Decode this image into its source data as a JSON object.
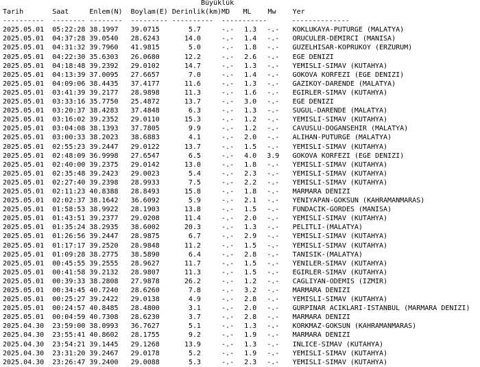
{
  "magnitude_group_title": "Büyüklük",
  "headers": {
    "date": "Tarih",
    "time": "Saat",
    "lat": "Enlem(N)",
    "lon": "Boylam(E)",
    "depth": "Derinlik(km)",
    "md": "MD",
    "ml": "ML",
    "mw": "Mw",
    "place": "Yer"
  },
  "separators": {
    "date": "----------",
    "time": "--------",
    "lat": "--------",
    "lon": "---------",
    "depth": "----------",
    "mag": "-----------",
    "place": "--------------"
  },
  "rows": [
    {
      "date": "2025.05.01",
      "time": "05:22:28",
      "lat": "38.1997",
      "lon": "39.0715",
      "depth": "5.7",
      "md": "-.-",
      "ml": "1.3",
      "mw": "-.-",
      "place": "KOKLUKAYA-PUTURGE (MALATYA)"
    },
    {
      "date": "2025.05.01",
      "time": "04:37:28",
      "lat": "39.0540",
      "lon": "28.6243",
      "depth": "14.0",
      "md": "-.-",
      "ml": "1.4",
      "mw": "-.-",
      "place": "ORUCULER-DEMIRCI (MANISA)"
    },
    {
      "date": "2025.05.01",
      "time": "04:31:32",
      "lat": "39.7960",
      "lon": "41.9815",
      "depth": "5.0",
      "md": "-.-",
      "ml": "1.8",
      "mw": "-.-",
      "place": "GUZELHISAR-KOPRUKOY (ERZURUM)"
    },
    {
      "date": "2025.05.01",
      "time": "04:22:30",
      "lat": "35.6303",
      "lon": "26.0680",
      "depth": "12.2",
      "md": "-.-",
      "ml": "2.6",
      "mw": "-.-",
      "place": "EGE DENIZI"
    },
    {
      "date": "2025.05.01",
      "time": "04:18:48",
      "lat": "39.2392",
      "lon": "29.0102",
      "depth": "14.7",
      "md": "-.-",
      "ml": "1.3",
      "mw": "-.-",
      "place": "YEMISLI-SIMAV (KUTAHYA)"
    },
    {
      "date": "2025.05.01",
      "time": "04:13:39",
      "lat": "37.0095",
      "lon": "27.6657",
      "depth": "7.0",
      "md": "-.-",
      "ml": "1.4",
      "mw": "-.-",
      "place": "GOKOVA KORFEZI (EGE DENIZI)"
    },
    {
      "date": "2025.05.01",
      "time": "04:09:06",
      "lat": "38.4435",
      "lon": "37.4177",
      "depth": "11.6",
      "md": "-.-",
      "ml": "1.3",
      "mw": "-.-",
      "place": "GAZIKOY-DARENDE (MALATYA)"
    },
    {
      "date": "2025.05.01",
      "time": "03:41:39",
      "lat": "39.2177",
      "lon": "28.9898",
      "depth": "11.3",
      "md": "-.-",
      "ml": "1.6",
      "mw": "-.-",
      "place": "EGIRLER-SIMAV (KUTAHYA)"
    },
    {
      "date": "2025.05.01",
      "time": "03:33:16",
      "lat": "35.7750",
      "lon": "25.4872",
      "depth": "13.7",
      "md": "-.-",
      "ml": "3.0",
      "mw": "-.-",
      "place": "EGE DENIZI"
    },
    {
      "date": "2025.05.01",
      "time": "03:20:37",
      "lat": "38.4283",
      "lon": "37.4848",
      "depth": "6.3",
      "md": "-.-",
      "ml": "1.3",
      "mw": "-.-",
      "place": "SUGUL-DARENDE (MALATYA)"
    },
    {
      "date": "2025.05.01",
      "time": "03:16:02",
      "lat": "39.2352",
      "lon": "29.0110",
      "depth": "15.3",
      "md": "-.-",
      "ml": "1.2",
      "mw": "-.-",
      "place": "YEMISLI-SIMAV (KUTAHYA)"
    },
    {
      "date": "2025.05.01",
      "time": "03:04:08",
      "lat": "38.1393",
      "lon": "37.7805",
      "depth": "9.9",
      "md": "-.-",
      "ml": "1.2",
      "mw": "-.-",
      "place": "CAVUSLU-DOGANSEHIR (MALATYA)"
    },
    {
      "date": "2025.05.01",
      "time": "03:00:33",
      "lat": "38.2023",
      "lon": "38.6883",
      "depth": "4.1",
      "md": "-.-",
      "ml": "2.0",
      "mw": "-.-",
      "place": "ALIHAN-PUTURGE (MALATYA)"
    },
    {
      "date": "2025.05.01",
      "time": "02:55:23",
      "lat": "39.2447",
      "lon": "29.0122",
      "depth": "13.7",
      "md": "-.-",
      "ml": "1.5",
      "mw": "-.-",
      "place": "YEMISLI-SIMAV (KUTAHYA)"
    },
    {
      "date": "2025.05.01",
      "time": "02:48:09",
      "lat": "36.9998",
      "lon": "27.6547",
      "depth": "6.5",
      "md": "-.-",
      "ml": "4.0",
      "mw": "3.9",
      "place": "GOKOVA KORFEZI (EGE DENIZI)"
    },
    {
      "date": "2025.05.01",
      "time": "02:40:00",
      "lat": "39.2375",
      "lon": "29.0142",
      "depth": "13.0",
      "md": "-.-",
      "ml": "1.8",
      "mw": "-.-",
      "place": "YEMISLI-SIMAV (KUTAHYA)"
    },
    {
      "date": "2025.05.01",
      "time": "02:35:48",
      "lat": "39.2423",
      "lon": "29.0023",
      "depth": "5.4",
      "md": "-.-",
      "ml": "2.3",
      "mw": "-.-",
      "place": "YEMISLI-SIMAV (KUTAHYA)"
    },
    {
      "date": "2025.05.01",
      "time": "02:27:40",
      "lat": "39.2398",
      "lon": "28.9933",
      "depth": "7.5",
      "md": "-.-",
      "ml": "2.2",
      "mw": "-.-",
      "place": "YEMISLI-SIMAV (KUTAHYA)"
    },
    {
      "date": "2025.05.01",
      "time": "02:11:23",
      "lat": "40.8388",
      "lat2": "",
      "lon": "28.8493",
      "depth": "15.8",
      "md": "-.-",
      "ml": "1.8",
      "mw": "-.-",
      "place": "MARMARA DENIZI"
    },
    {
      "date": "2025.05.01",
      "time": "02:02:37",
      "lat": "38.1642",
      "lon": "36.6092",
      "depth": "5.9",
      "md": "-.-",
      "ml": "2.1",
      "mw": "-.-",
      "place": "YENIYAPAN-GOKSUN (KAHRAMANMARAS)"
    },
    {
      "date": "2025.05.01",
      "time": "01:58:53",
      "lat": "38.9922",
      "lon": "28.1903",
      "depth": "13.8",
      "md": "-.-",
      "ml": "1.5",
      "mw": "-.-",
      "place": "FUNDACIK-GORDES (MANISA)"
    },
    {
      "date": "2025.05.01",
      "time": "01:43:51",
      "lat": "39.2377",
      "lon": "29.0208",
      "depth": "11.4",
      "md": "-.-",
      "ml": "2.0",
      "mw": "-.-",
      "place": "YEMISLI-SIMAV (KUTAHYA)"
    },
    {
      "date": "2025.05.01",
      "time": "01:35:24",
      "lat": "38.2935",
      "lon": "38.6002",
      "depth": "20.3",
      "md": "-.-",
      "ml": "1.3",
      "mw": "-.-",
      "place": "PELITLI-(MALATYA)"
    },
    {
      "date": "2025.05.01",
      "time": "01:26:56",
      "lat": "39.2447",
      "lon": "28.9875",
      "depth": "6.7",
      "md": "-.-",
      "ml": "2.9",
      "mw": "-.-",
      "place": "YEMISLI-SIMAV (KUTAHYA)"
    },
    {
      "date": "2025.05.01",
      "time": "01:17:17",
      "lat": "39.2520",
      "lon": "28.9848",
      "depth": "11.2",
      "md": "-.-",
      "ml": "1.5",
      "mw": "-.-",
      "place": "YEMISLI-SIMAV (KUTAHYA)"
    },
    {
      "date": "2025.05.01",
      "time": "01:09:28",
      "lat": "38.2775",
      "lon": "38.5890",
      "depth": "6.4",
      "md": "-.-",
      "ml": "2.8",
      "mw": "-.-",
      "place": "TANISIK-(MALATYA)"
    },
    {
      "date": "2025.05.01",
      "time": "00:45:55",
      "lat": "39.2555",
      "lon": "28.9627",
      "depth": "11.7",
      "md": "-.-",
      "ml": "1.5",
      "mw": "-.-",
      "place": "YENILER-SIMAV (KUTAHYA)"
    },
    {
      "date": "2025.05.01",
      "time": "00:41:58",
      "lat": "39.2132",
      "lon": "28.9807",
      "depth": "11.3",
      "md": "-.-",
      "ml": "1.5",
      "mw": "-.-",
      "place": "EGIRLER-SIMAV (KUTAHYA)"
    },
    {
      "date": "2025.05.01",
      "time": "00:39:33",
      "lat": "38.2808",
      "lon": "27.9878",
      "depth": "26.2",
      "md": "-.-",
      "ml": "1.2",
      "mw": "-.-",
      "place": "CAGLIYAN-ODEMIS (IZMIR)"
    },
    {
      "date": "2025.05.01",
      "time": "00:34:45",
      "lat": "40.7240",
      "lon": "28.6260",
      "depth": "7.8",
      "md": "-.-",
      "ml": "3.2",
      "mw": "-.-",
      "place": "MARMARA DENIZI"
    },
    {
      "date": "2025.05.01",
      "time": "00:25:27",
      "lat": "39.2422",
      "lon": "29.0138",
      "depth": "4.9",
      "md": "-.-",
      "ml": "2.8",
      "mw": "-.-",
      "place": "YEMISLI-SIMAV (KUTAHYA)"
    },
    {
      "date": "2025.05.01",
      "time": "00:24:57",
      "lat": "40.8485",
      "lon": "28.4800",
      "depth": "3.1",
      "md": "-.-",
      "ml": "2.0",
      "mw": "-.-",
      "place": "GURPINAR ACIKLARI-ISTANBUL (MARMARA DENIZI)"
    },
    {
      "date": "2025.05.01",
      "time": "00:04:59",
      "lat": "40.7308",
      "lon": "28.6230",
      "depth": "3.7",
      "md": "-.-",
      "ml": "2.8",
      "mw": "-.-",
      "place": "MARMARA DENIZI"
    },
    {
      "date": "2025.04.30",
      "time": "23:59:00",
      "lat": "38.0993",
      "lon": "36.7627",
      "depth": "5.1",
      "md": "-.-",
      "ml": "1.3",
      "mw": "-.-",
      "place": "KORKMAZ-GOKSUN (KAHRAMANMARAS)"
    },
    {
      "date": "2025.04.30",
      "time": "23:55:41",
      "lat": "40.8602",
      "lon": "28.1755",
      "depth": "9.2",
      "md": "-.-",
      "ml": "1.9",
      "mw": "-.-",
      "place": "MARMARA DENIZI"
    },
    {
      "date": "2025.04.30",
      "time": "23:54:21",
      "lat": "39.1445",
      "lon": "29.1268",
      "depth": "13.9",
      "md": "-.-",
      "ml": "1.3",
      "mw": "-.-",
      "place": "INLICE-SIMAV (KUTAHYA)"
    },
    {
      "date": "2025.04.30",
      "time": "23:31:20",
      "lat": "39.2467",
      "lon": "29.0178",
      "depth": "5.2",
      "md": "-.-",
      "ml": "1.9",
      "mw": "-.-",
      "place": "YEMISLI-SIMAV (KUTAHYA)"
    },
    {
      "date": "2025.04.30",
      "time": "23:26:47",
      "lat": "39.2400",
      "lon": "29.0088",
      "depth": "5.3",
      "md": "-.-",
      "ml": "2.3",
      "mw": "-.-",
      "place": "YEMISLI-SIMAV (KUTAHYA)"
    }
  ]
}
